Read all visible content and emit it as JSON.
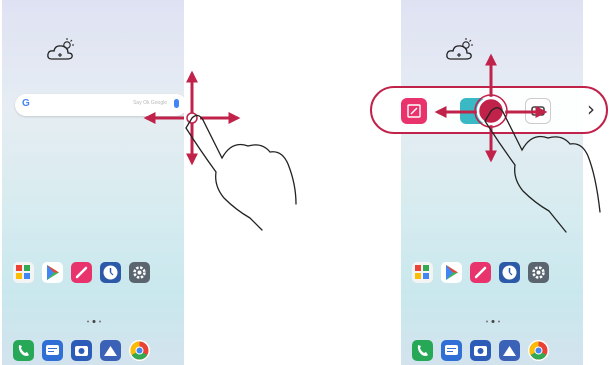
{
  "search": {
    "logo": "G",
    "placeholder": "Say Ok Google"
  },
  "apps": {
    "row": [
      {
        "name": "Google",
        "icon": "folder-icon",
        "color": "#f4f4f4"
      },
      {
        "name": "Play Store",
        "icon": "play-store-icon",
        "color": "#ffffff"
      },
      {
        "name": "QuickMemo+",
        "icon": "quickmemo-icon",
        "color": "#e8336c"
      },
      {
        "name": "Clock",
        "icon": "clock-icon",
        "color": "#2d5aa8"
      },
      {
        "name": "Settings",
        "icon": "settings-icon",
        "color": "#5a6570"
      }
    ],
    "dock": [
      {
        "icon": "phone-icon",
        "color": "#27a856"
      },
      {
        "icon": "messages-icon",
        "color": "#2f6fd6"
      },
      {
        "icon": "camera-icon",
        "color": "#2b5db8"
      },
      {
        "icon": "gallery-icon",
        "color": "#3c62b8"
      },
      {
        "icon": "chrome-icon",
        "color": "#ffffff"
      }
    ]
  },
  "accent": "#c0224a",
  "chevron": "›"
}
